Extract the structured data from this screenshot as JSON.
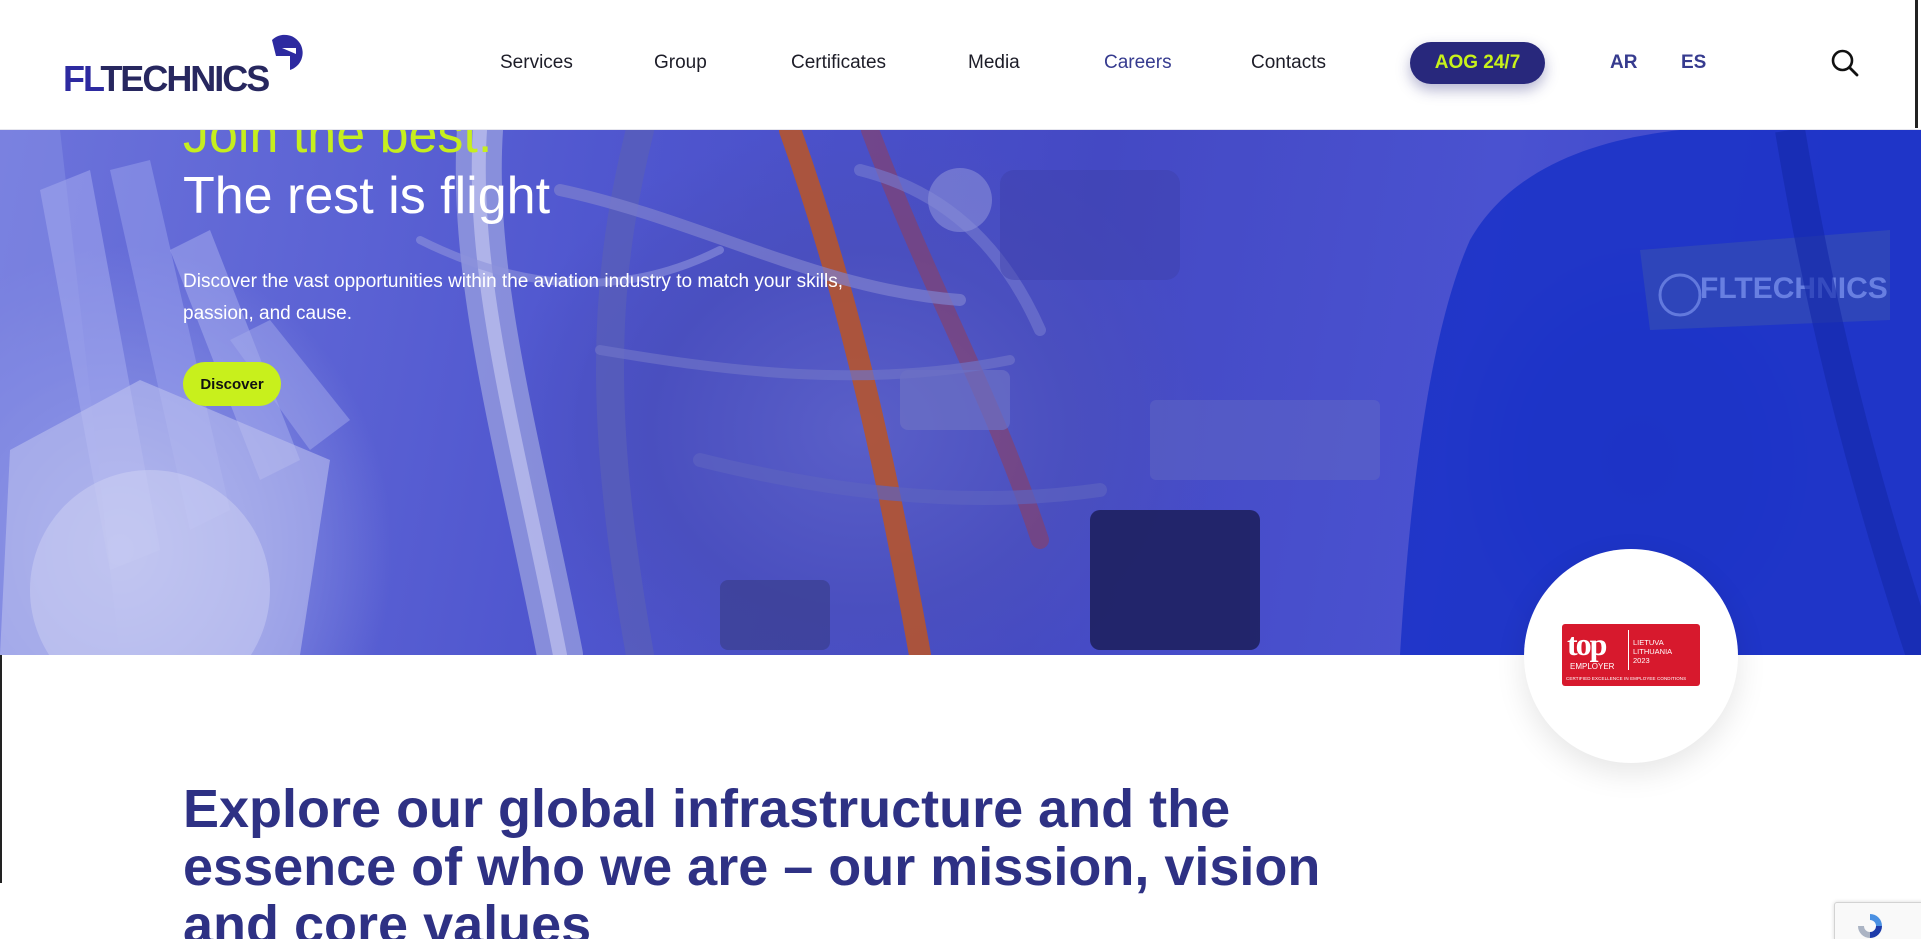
{
  "brand": {
    "logo_text_a": "FL",
    "logo_text_b": "TECHNICS"
  },
  "nav": {
    "items": [
      {
        "label": "Services"
      },
      {
        "label": "Group"
      },
      {
        "label": "Certificates"
      },
      {
        "label": "Media"
      },
      {
        "label": "Careers",
        "active": true
      },
      {
        "label": "Contacts"
      }
    ],
    "aog_label": "AOG 24/7",
    "languages": [
      "AR",
      "ES"
    ]
  },
  "hero": {
    "title_line1": "Join the best.",
    "title_line2": "The rest is flight",
    "description": "Discover the vast opportunities within the aviation industry to match your skills, passion, and cause.",
    "cta_label": "Discover"
  },
  "badge": {
    "top": "top",
    "employer": "EMPLOYER",
    "country_lt": "LIETUVA",
    "country_en": "LITHUANIA",
    "year": "2023",
    "footer": "CERTIFIED EXCELLENCE IN EMPLOYEE CONDITIONS"
  },
  "explore": {
    "heading": "Explore our global infrastructure and the essence of who we are – our mission, vision and core values"
  },
  "colors": {
    "brand_navy": "#28287c",
    "accent_lime": "#c8f01c",
    "heading_blue": "#2e3184",
    "badge_red": "#d7192d"
  }
}
